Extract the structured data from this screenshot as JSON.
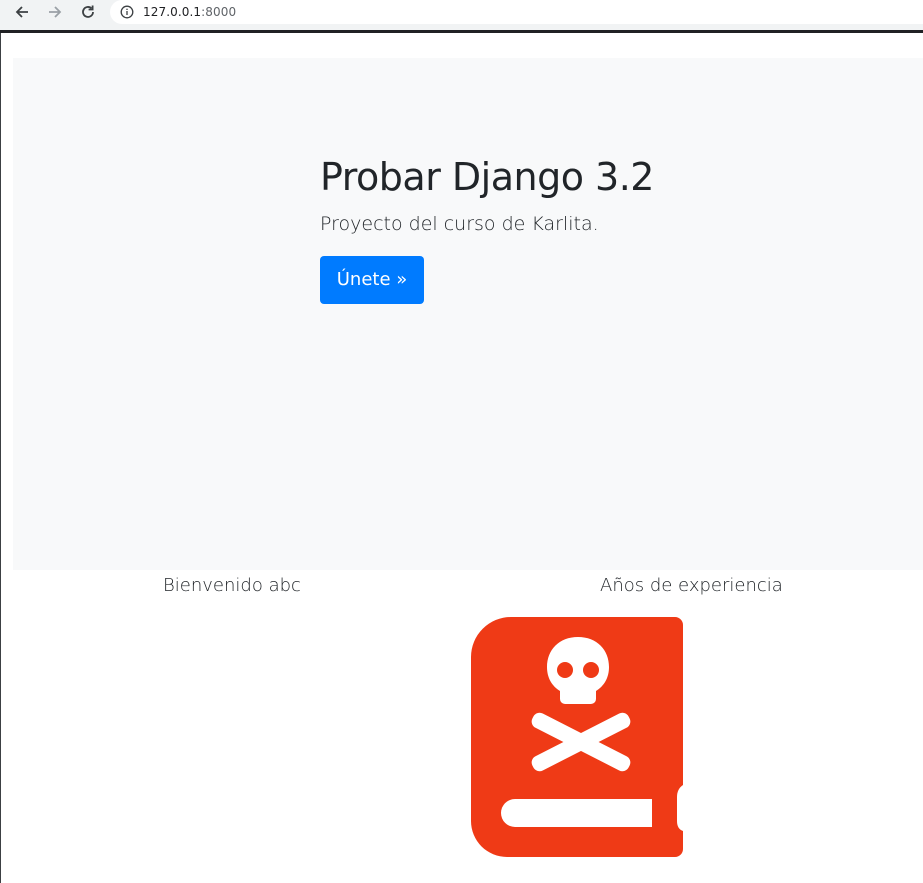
{
  "browser": {
    "url_host": "127.0.0.1",
    "url_port": ":8000",
    "back_icon": "arrow-left-icon",
    "forward_icon": "arrow-right-icon",
    "reload_icon": "reload-icon",
    "info_icon": "info-icon"
  },
  "jumbotron": {
    "title": "Probar Django 3.2",
    "subtitle": "Proyecto del curso de Karlita.",
    "button_label": "Únete »",
    "background_color": "#f8f9fa",
    "button_color": "#007bff"
  },
  "content": {
    "welcome_text": "Bienvenido abc",
    "years_text": "Años de experiencia",
    "book_icon": "skull-book-icon",
    "book_color": "#ef3a16"
  }
}
